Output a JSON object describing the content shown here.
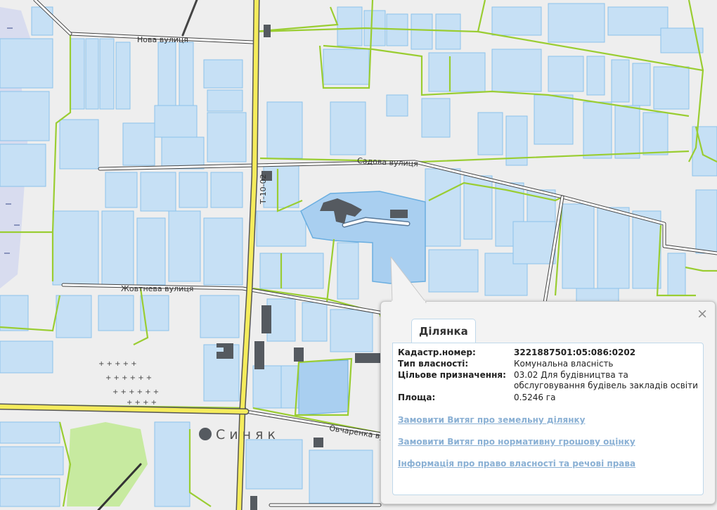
{
  "map": {
    "street_labels": [
      "Нова вулиця",
      "Садова вулиця",
      "Жовтнева вулиця",
      "Овчаренка вулиця",
      "Т-10-02"
    ],
    "town_label": "Синяк"
  },
  "popup": {
    "close_symbol": "×",
    "tab_label": "Ділянка",
    "fields": [
      {
        "key": "Кадастр.номер:",
        "value": "3221887501:05:086:0202"
      },
      {
        "key": "Тип власності:",
        "value": "Комунальна власність"
      },
      {
        "key": "Цільове призначення:",
        "value": "03.02 Для будівництва та обслуговування будівель закладів освіти"
      },
      {
        "key": "Площа:",
        "value": "0.5246 га"
      }
    ],
    "links": [
      "Замовити Витяг про земельну ділянку",
      "Замовити Витяг про нормативну грошову оцінку",
      "Інформація про право власності та речові права"
    ]
  },
  "colors": {
    "parcel_fill": "#c6e0f5",
    "parcel_stroke": "#8cc2ea",
    "boundary_green": "#9acd32",
    "road_yellow": "#f5ec5c",
    "building": "#555a60",
    "park": "#c7eaa0",
    "link": "#8ab0d4"
  }
}
